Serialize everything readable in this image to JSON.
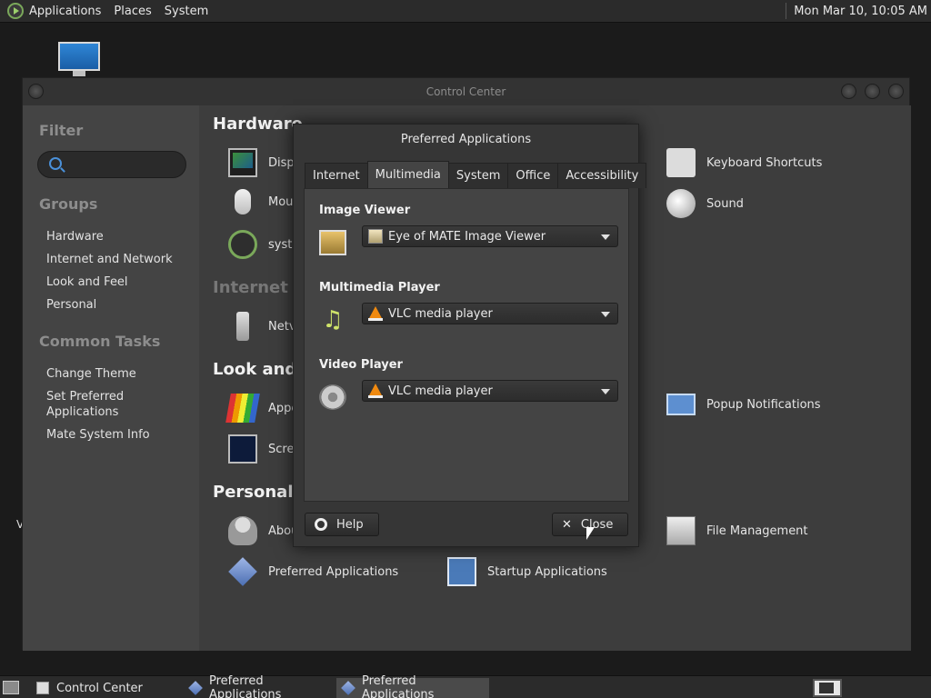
{
  "top_panel": {
    "menus": [
      "Applications",
      "Places",
      "System"
    ],
    "clock": "Mon Mar 10, 10:05 AM"
  },
  "desktop": {
    "icons": [
      "computer-icon"
    ],
    "stray_text": "V"
  },
  "control_center": {
    "title": "Control Center",
    "sidebar": {
      "filter_heading": "Filter",
      "search_placeholder": "",
      "groups_heading": "Groups",
      "groups": [
        "Hardware",
        "Internet and Network",
        "Look and Feel",
        "Personal"
      ],
      "tasks_heading": "Common Tasks",
      "tasks": [
        "Change Theme",
        "Set Preferred\nApplications",
        "Mate System Info"
      ]
    },
    "categories": {
      "hardware": "Hardware",
      "internet": "Internet a",
      "look": "Look and F",
      "personal": "Personal"
    },
    "items": {
      "display": "Disp",
      "mouse": "Mou",
      "system": "syste",
      "network": "Netv",
      "appearance": "Appe",
      "screensaver": "Scree",
      "about": "Abou",
      "preferred_apps": "Preferred Applications",
      "startup_apps": "Startup Applications",
      "keyboard_shortcuts": "Keyboard Shortcuts",
      "sound": "Sound",
      "popup_notifications": "Popup Notifications",
      "file_management": "File Management"
    }
  },
  "dialog": {
    "title": "Preferred Applications",
    "tabs": [
      "Internet",
      "Multimedia",
      "System",
      "Office",
      "Accessibility"
    ],
    "active_tab": "Multimedia",
    "sections": {
      "image_viewer": {
        "label": "Image Viewer",
        "value": "Eye of MATE Image Viewer"
      },
      "multimedia_player": {
        "label": "Multimedia Player",
        "value": "VLC media player"
      },
      "video_player": {
        "label": "Video Player",
        "value": "VLC media player"
      }
    },
    "help_label": "Help",
    "close_label": "Close"
  },
  "taskbar": {
    "tasks": [
      "Control Center",
      "Preferred Applications",
      "Preferred Applications"
    ],
    "active_task_index": 2
  }
}
